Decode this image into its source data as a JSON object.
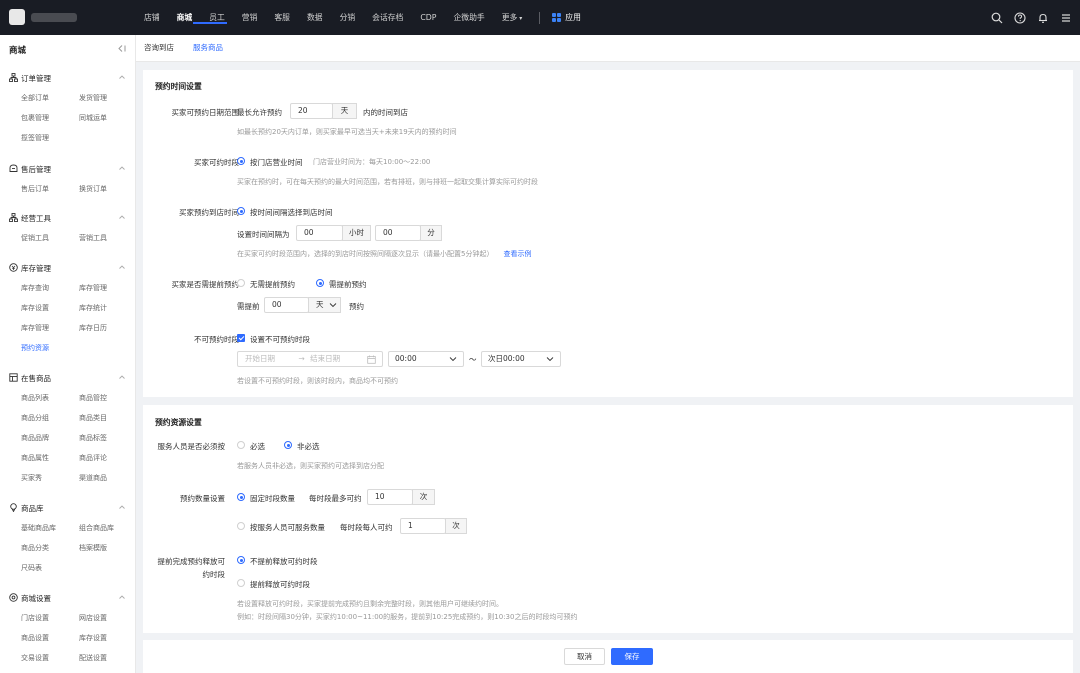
{
  "topnav": {
    "items": [
      "店铺",
      "商城",
      "员工",
      "营销",
      "客服",
      "数据",
      "分销",
      "会话存档",
      "CDP",
      "企微助手"
    ],
    "more_label": "更多",
    "app_label": "应用"
  },
  "sidebar": {
    "title": "商城",
    "groups": [
      {
        "title": "订单管理",
        "items": [
          "全部订单",
          "发货管理",
          "包裹管理",
          "同城运单",
          "揽签管理"
        ]
      },
      {
        "title": "售后管理",
        "items": [
          "售后订单",
          "换货订单"
        ]
      },
      {
        "title": "经营工具",
        "items": [
          "促销工具",
          "营销工具"
        ]
      },
      {
        "title": "库存管理",
        "items": [
          "库存查询",
          "库存管理",
          "库存设置",
          "库存统计",
          "库存管理",
          "库存日历",
          "预约资源"
        ]
      },
      {
        "title": "在售商品",
        "items": [
          "商品列表",
          "商品管控",
          "商品分组",
          "商品类目",
          "商品品牌",
          "商品标签",
          "商品属性",
          "商品评论",
          "买家秀",
          "渠道商品"
        ]
      },
      {
        "title": "商品库",
        "items": [
          "基础商品库",
          "组合商品库",
          "商品分类",
          "档案模版",
          "尺码表"
        ]
      },
      {
        "title": "商城设置",
        "items": [
          "门店设置",
          "网店设置",
          "商品设置",
          "库存设置",
          "交易设置",
          "配送设置"
        ]
      }
    ]
  },
  "tabs": [
    "咨询到店",
    "服务商品"
  ],
  "booking_time": {
    "title": "预约时间设置",
    "date_range": {
      "label": "买家可预约日期范围",
      "prefix": "最长允许预约",
      "value": "20",
      "unit": "天",
      "suffix": "内的时间到店",
      "hint": "如最长预约20天内订单，则买家最早可选当天+未来19天内的预约时间"
    },
    "period": {
      "label": "买家可约时段",
      "option": "按门店营业时间",
      "note": "门店营业时间为：每天10:00～22:00",
      "hint": "买家在预约时，可在每天预约的最大时间范围，若有排班，则与排班一起取交集计算实际可约时段"
    },
    "arrival": {
      "label": "买家预约到店时间",
      "option": "按时间间隔选择到店时间",
      "interval_label": "设置时间间隔为",
      "hours": "00",
      "hours_unit": "小时",
      "minutes": "00",
      "minutes_unit": "分",
      "hint": "在买家可约时段范围内，选择的到店时间按照间隔逐次显示（请最小配置5分钟起）",
      "hint_link": "查看示例"
    },
    "advance": {
      "label": "买家是否需提前预约",
      "option_no": "无需提前预约",
      "option_yes": "需提前预约",
      "need_label": "需提前",
      "value": "00",
      "unit": "天",
      "suffix": "预约"
    },
    "unavailable": {
      "label": "不可预约时段",
      "checkbox": "设置不可预约时段",
      "start_placeholder": "开始日期",
      "range_sep": "→",
      "end_placeholder": "结束日期",
      "start_time": "00:00",
      "tilde": "～",
      "end_time": "次日00:00",
      "hint": "若设置不可预约时段，则该时段内，商品均不可预约"
    }
  },
  "booking_resource": {
    "title": "预约资源设置",
    "staff": {
      "label": "服务人员是否必须按",
      "option_required": "必选",
      "option_optional": "非必选",
      "hint": "若服务人员非必选，则买家预约可选择到店分配"
    },
    "quantity": {
      "label": "预约数量设置",
      "option_fixed": "固定时段数量",
      "fixed_label": "每时段最多可约",
      "fixed_value": "10",
      "fixed_unit": "次",
      "option_staff": "按服务人员可服务数量",
      "staff_label": "每时段每人可约",
      "staff_value": "1",
      "staff_unit": "次"
    },
    "release": {
      "label_line1": "提前完成预约释放可",
      "label_line2": "约时段",
      "option_no": "不提前释放可约时段",
      "option_yes": "提前释放可约时段",
      "hint1": "若设置释放可约时段，买家提前完成预约且剩余完整时段，则其他用户可继续约时间。",
      "hint2": "例如：时段间隔30分钟，买家约10:00~11:00的服务，提前到10:25完成预约，则10:30之后的时段均可预约"
    }
  },
  "footer": {
    "cancel": "取消",
    "save": "保存"
  },
  "colors": {
    "accent": "#2f6bff",
    "topbar": "#191c24"
  }
}
